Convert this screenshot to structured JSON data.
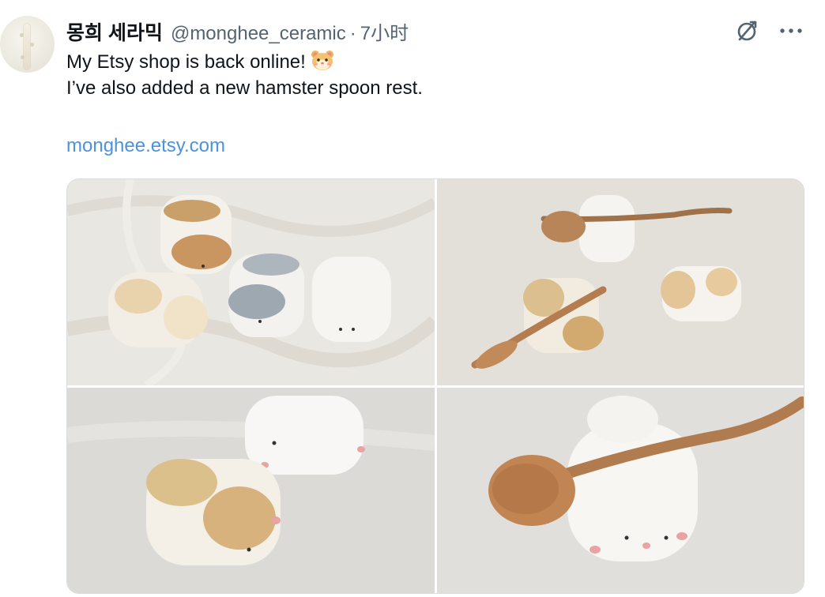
{
  "tweet": {
    "display_name": "몽희 세라믹",
    "handle": "@monghee_ceramic",
    "separator": "·",
    "time": "7小时",
    "text_line1": "My Etsy shop is back online!",
    "text_emoji": "🐹",
    "text_line2": "I’ve also added a new hamster spoon rest.",
    "link": "monghee.etsy.com"
  },
  "actions": {
    "translate_icon": "grok-translate-icon",
    "more_icon": "more-horizontal-icon"
  },
  "media": [
    {
      "name": "hamster spoon rests on white cloth"
    },
    {
      "name": "hamster spoon rests with wooden spoons"
    },
    {
      "name": "two hamster spoon rests close-up"
    },
    {
      "name": "hamster spoon rest with wooden spoon"
    }
  ],
  "colors": {
    "text": "#0f1419",
    "secondary": "#536471",
    "link": "#4b93dd",
    "border": "#d6dbdf"
  }
}
